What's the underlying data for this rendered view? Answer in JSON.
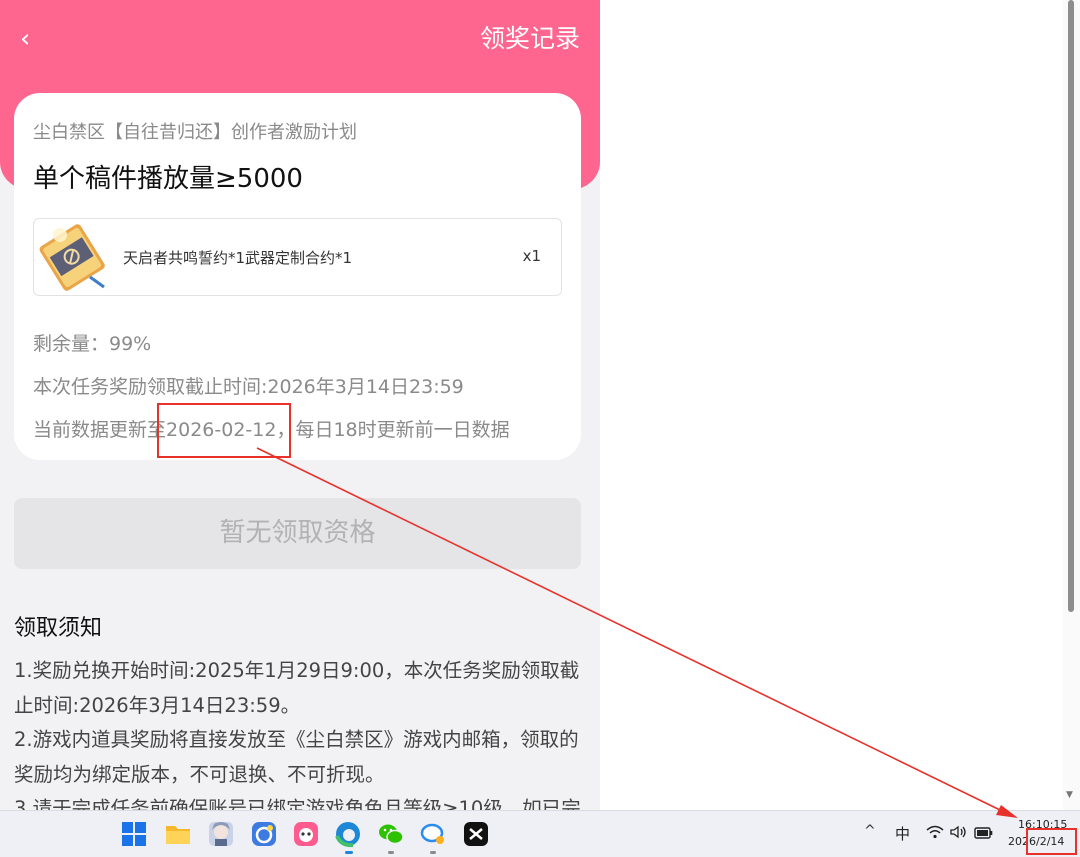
{
  "header": {
    "back_glyph": "‹",
    "title": "领奖记录",
    "background_color": "#fe6690"
  },
  "card": {
    "campaign": "尘白禁区【自往昔归还】创作者激励计划",
    "task": "单个稿件播放量≥5000",
    "item": {
      "icon": "reward-ticket-icon",
      "name": "天启者共鸣誓约*1武器定制合约*1",
      "quantity": "x1"
    },
    "remaining": "剩余量：99%",
    "deadline": "本次任务奖励领取截止时间:2026年3月14日23:59",
    "update_prefix": "当前数据更新至",
    "update_date": "2026-02-12",
    "update_suffix": "，每日18时更新前一日数据"
  },
  "claim_button": {
    "label": "暂无领取资格",
    "enabled": false
  },
  "notes": {
    "heading": "领取须知",
    "item1": "1.奖励兑换开始时间:2025年1月29日9:00，本次任务奖励领取截止时间:2026年3月14日23:59。",
    "item2": "2.游戏内道具奖励将直接发放至《尘白禁区》游戏内邮箱，领取的奖励均为绑定版本，不可退换、不可折现。",
    "item3": "3.请于完成任务前确保账号已绑定游戏角色且等级≥10级，如已完"
  },
  "taskbar": {
    "apps": [
      "windows-start-icon",
      "file-explorer-icon",
      "anime-avatar-icon",
      "blue-app-icon",
      "pink-app-icon",
      "edge-browser-icon",
      "wechat-icon",
      "chat-bubble-icon",
      "capcut-icon"
    ],
    "tray_chevron": "^",
    "ime": "中",
    "clock_time": "16:10:15",
    "clock_date": "2026/2/14"
  },
  "colors": {
    "annotation_red": "#e8312a",
    "accent_pink": "#fe6690"
  }
}
